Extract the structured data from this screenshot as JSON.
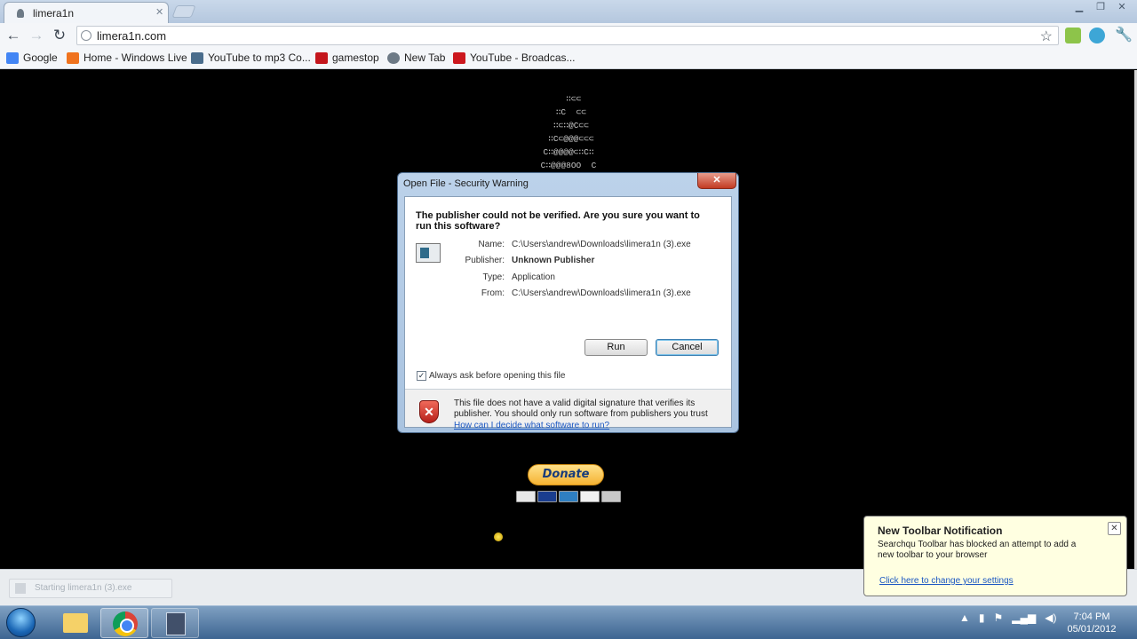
{
  "browser": {
    "tab_title": "limera1n",
    "url": "limera1n.com",
    "bookmarks": [
      {
        "label": "Google",
        "color": "#4285f4"
      },
      {
        "label": "Home - Windows Live",
        "color": "#f0731e"
      },
      {
        "label": "YouTube to mp3 Co...",
        "color": "#4a6d8c"
      },
      {
        "label": "gamestop",
        "color": "#c4161c"
      },
      {
        "label": "New Tab",
        "color": "#6d7a86"
      },
      {
        "label": "YouTube - Broadcas...",
        "color": "#cc181e"
      }
    ]
  },
  "page": {
    "ascii_art": "  ∷⊂⊂\n ∷C  ⊂⊂\n ∷⊂∷@C⊂⊂\n ∷C⊂@@@⊂⊂⊂\nC∷@@@@⊂∷C∷\nC∷@@@8OO  C",
    "donate_label": "Donate",
    "cards": [
      "MC",
      "VISA",
      "AMEX",
      "DISC",
      "BANK"
    ]
  },
  "dialog": {
    "title": "Open File - Security Warning",
    "question": "The publisher could not be verified.  Are you sure you want to run this software?",
    "fields": [
      {
        "label": "Name:",
        "value": "C:\\Users\\andrew\\Downloads\\limera1n (3).exe",
        "bold": false
      },
      {
        "label": "Publisher:",
        "value": "Unknown Publisher",
        "bold": true
      },
      {
        "label": "Type:",
        "value": "Application",
        "bold": false
      },
      {
        "label": "From:",
        "value": "C:\\Users\\andrew\\Downloads\\limera1n (3).exe",
        "bold": false
      }
    ],
    "run_label": "Run",
    "cancel_label": "Cancel",
    "checkbox_label": "Always ask before opening this file",
    "checkbox_checked": true,
    "warning_text": "This file does not have a valid digital signature that verifies its publisher.  You should only run software from publishers you trust",
    "warning_link": "How can I decide what software to run?"
  },
  "shelf": {
    "item_text": "Starting limera1n (3).exe"
  },
  "notification": {
    "title": "New Toolbar Notification",
    "body": "Searchqu Toolbar has blocked an attempt to add a new toolbar to your browser",
    "link": "Click here to change your settings"
  },
  "taskbar": {
    "time": "7:04 PM",
    "date": "05/01/2012"
  }
}
